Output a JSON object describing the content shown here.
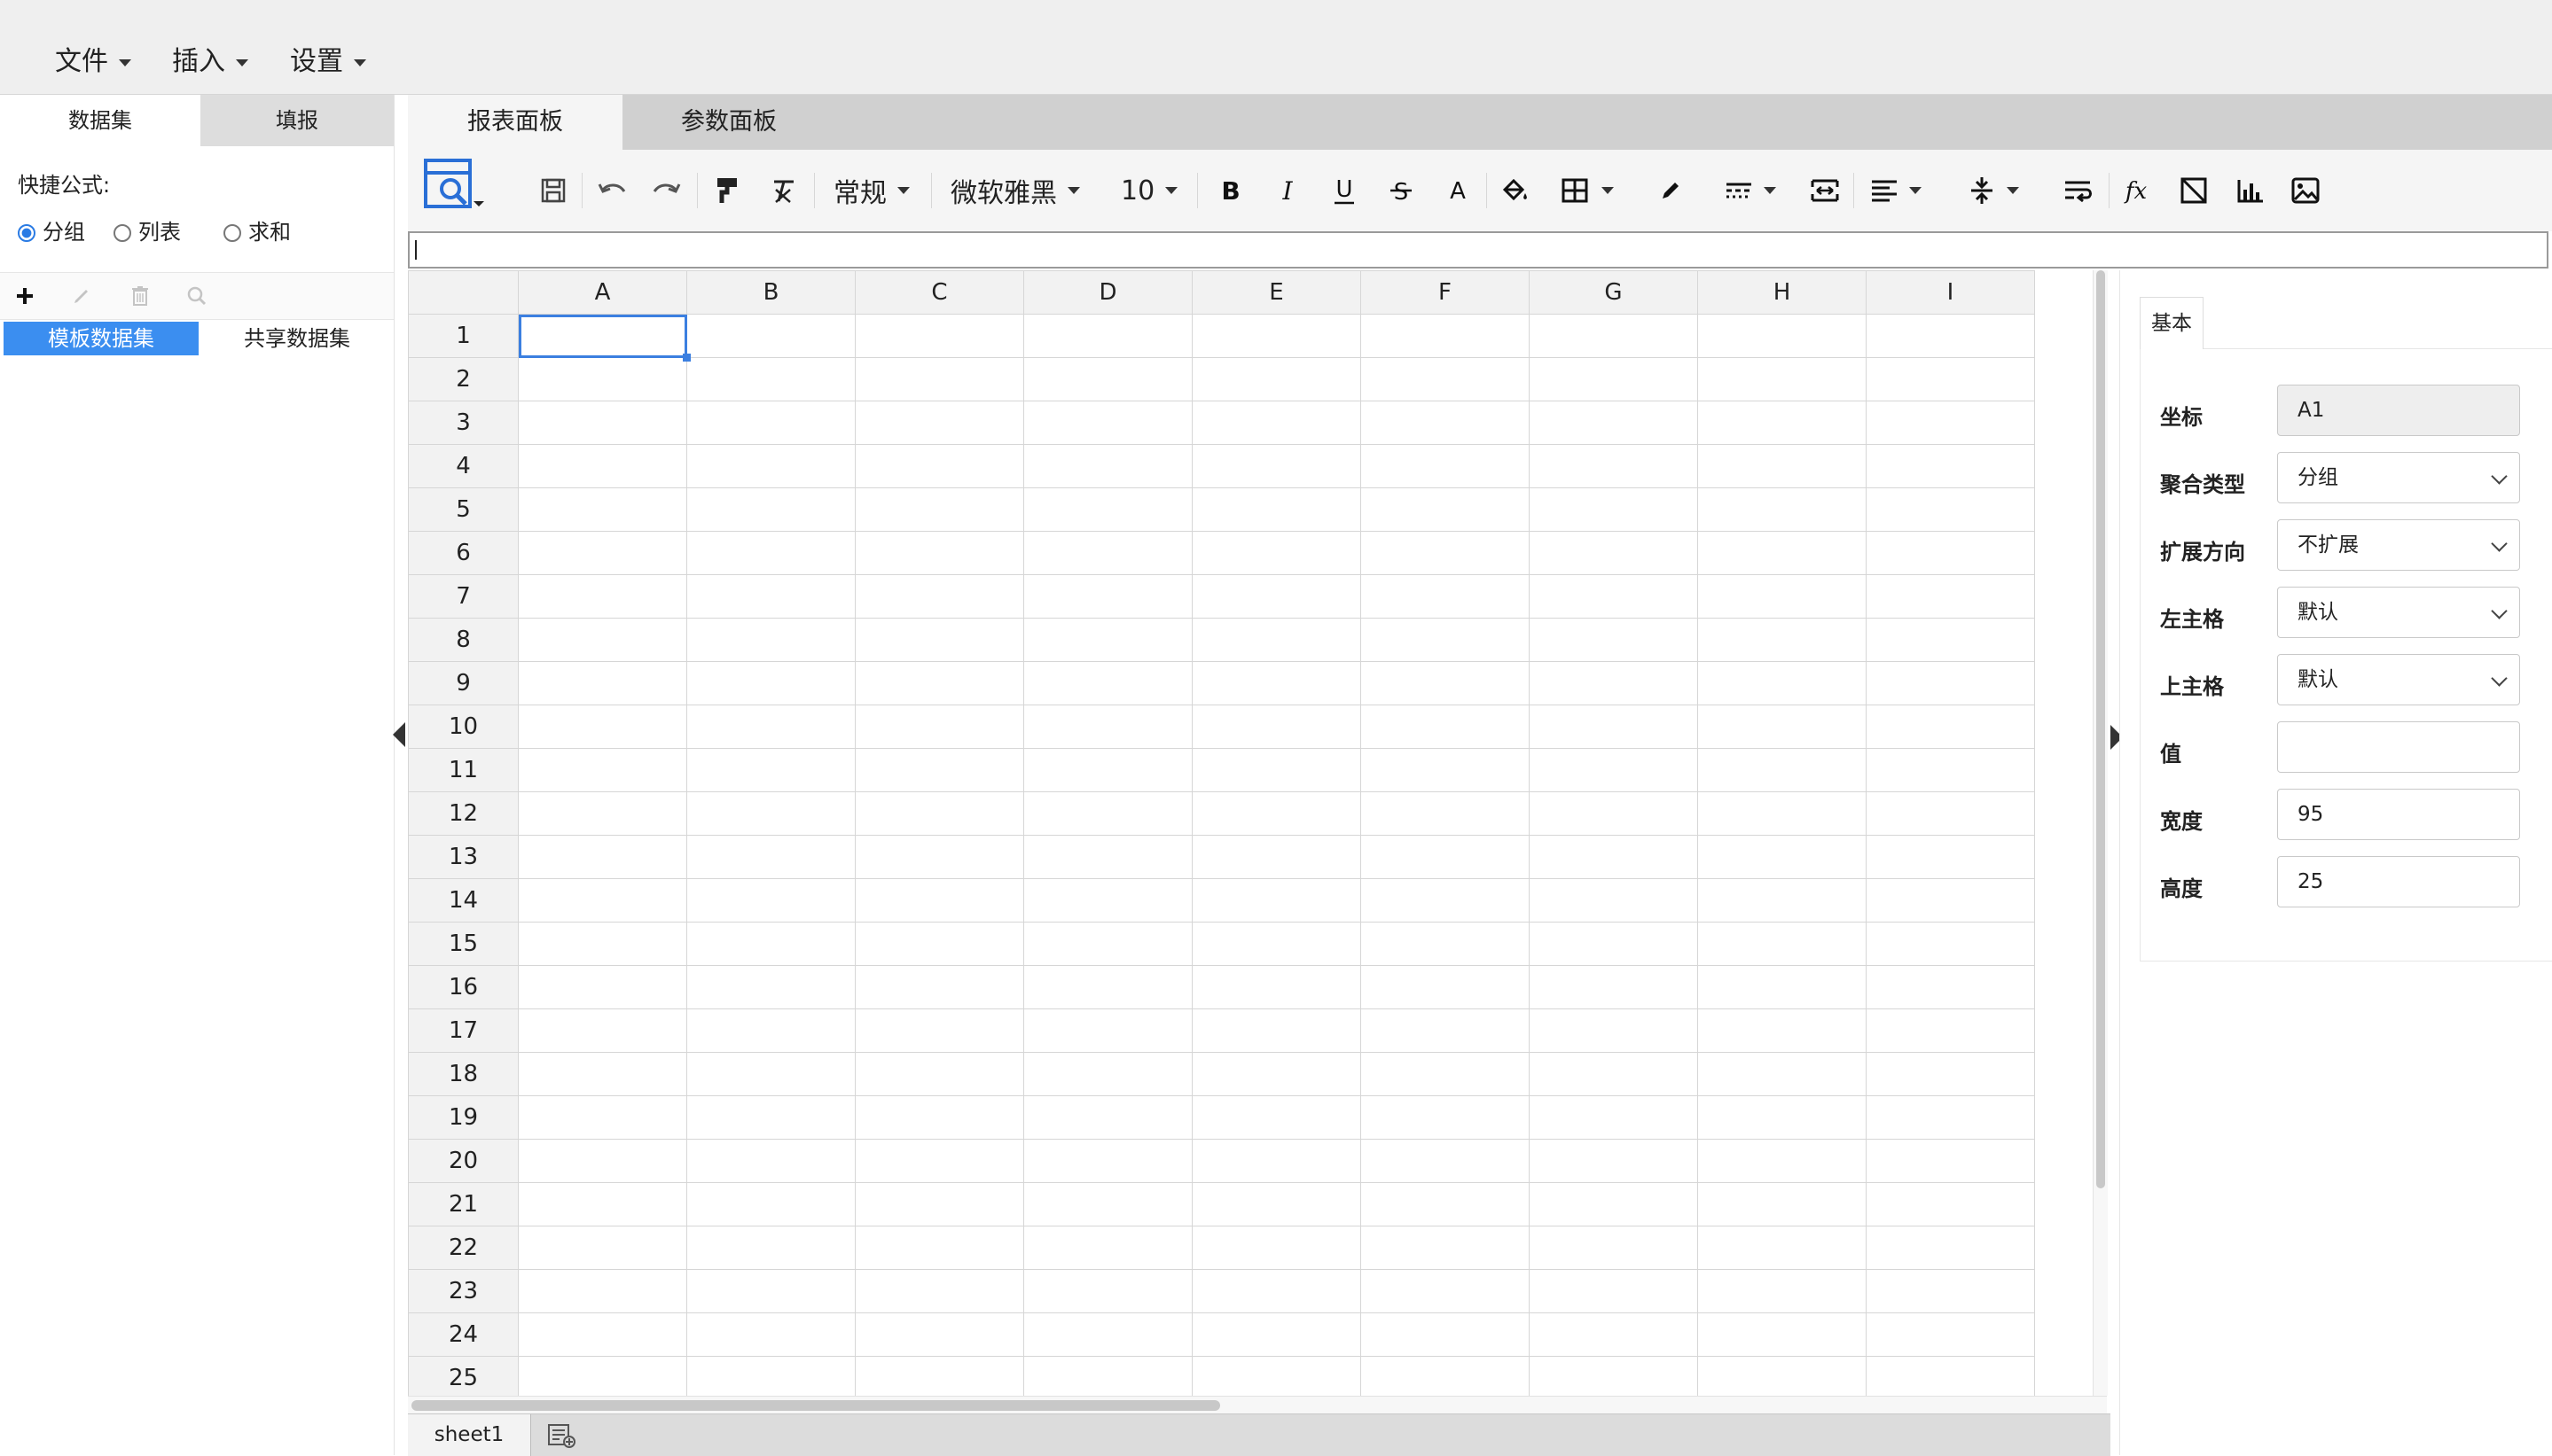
{
  "menu": [
    {
      "label": "文件"
    },
    {
      "label": "插入"
    },
    {
      "label": "设置"
    }
  ],
  "left": {
    "tabs": [
      "数据集",
      "填报"
    ],
    "quick_formula_label": "快捷公式:",
    "radios": [
      {
        "label": "分组",
        "checked": true
      },
      {
        "label": "列表",
        "checked": false
      },
      {
        "label": "求和",
        "checked": false
      }
    ],
    "dataset_tabs": [
      "模板数据集",
      "共享数据集"
    ]
  },
  "main_tabs": [
    "报表面板",
    "参数面板"
  ],
  "toolbar": {
    "format": "常规",
    "font": "微软雅黑",
    "size": "10"
  },
  "grid": {
    "columns": [
      "A",
      "B",
      "C",
      "D",
      "E",
      "F",
      "G",
      "H",
      "I"
    ],
    "rows": [
      "1",
      "2",
      "3",
      "4",
      "5",
      "6",
      "7",
      "8",
      "9",
      "10",
      "11",
      "12",
      "13",
      "14",
      "15",
      "16",
      "17",
      "18",
      "19",
      "20",
      "21",
      "22",
      "23",
      "24",
      "25"
    ],
    "selected_cell": "A1"
  },
  "sheets": [
    "sheet1"
  ],
  "props": {
    "tab": "基本",
    "fields": [
      {
        "label": "坐标",
        "value": "A1",
        "kind": "readonly"
      },
      {
        "label": "聚合类型",
        "value": "分组",
        "kind": "select"
      },
      {
        "label": "扩展方向",
        "value": "不扩展",
        "kind": "select"
      },
      {
        "label": "左主格",
        "value": "默认",
        "kind": "select"
      },
      {
        "label": "上主格",
        "value": "默认",
        "kind": "select"
      },
      {
        "label": "值",
        "value": "",
        "kind": "input"
      },
      {
        "label": "宽度",
        "value": "95",
        "kind": "input"
      },
      {
        "label": "高度",
        "value": "25",
        "kind": "input"
      }
    ]
  },
  "colors": {
    "accent": "#3b8ef0",
    "selection": "#3b7fe0",
    "toolbar_icon": "#333333",
    "preview_icon": "#2a6fd6"
  }
}
